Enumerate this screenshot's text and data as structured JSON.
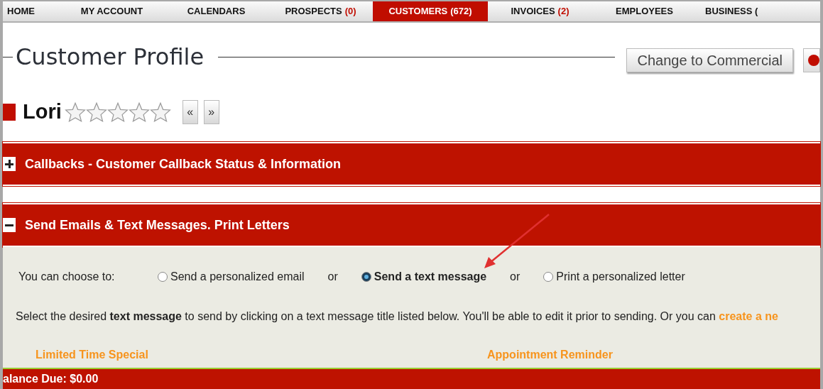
{
  "nav": [
    {
      "label": "HOME",
      "selected": false
    },
    {
      "label": "MY ACCOUNT",
      "selected": false
    },
    {
      "label": "CALENDARS",
      "selected": false
    },
    {
      "label": "PROSPECTS",
      "count": "(0)",
      "selected": false
    },
    {
      "label": "CUSTOMERS",
      "count": "(672)",
      "selected": true
    },
    {
      "label": "INVOICES",
      "count": "(2)",
      "selected": false
    },
    {
      "label": "EMPLOYEES",
      "selected": false
    },
    {
      "label": "BUSINESS (",
      "selected": false
    }
  ],
  "page_title": "Customer Profile",
  "change_button": "Change to Commercial",
  "customer": {
    "name": "Lori",
    "stars": 0,
    "prev": "«",
    "next": "»"
  },
  "sections": [
    {
      "title": "Callbacks - Customer Callback Status & Information",
      "expanded": false
    },
    {
      "title": "Send Emails & Text Messages. Print Letters",
      "expanded": true
    }
  ],
  "choose_label": "You can choose to:",
  "options": [
    {
      "label": "Send a personalized email",
      "selected": false
    },
    {
      "label": "Send a text message",
      "selected": true
    },
    {
      "label": "Print a personalized letter",
      "selected": false
    }
  ],
  "separators": [
    "or",
    "or"
  ],
  "instructions": "Select the desired **text message** to send by clicking on a text message title listed below. You'll be able to edit it prior to sending. Or you can ",
  "create_link": "create a ne",
  "messages": [
    "Limited Time Special",
    "Appointment Reminder"
  ],
  "balance": "alance Due: $0.00"
}
